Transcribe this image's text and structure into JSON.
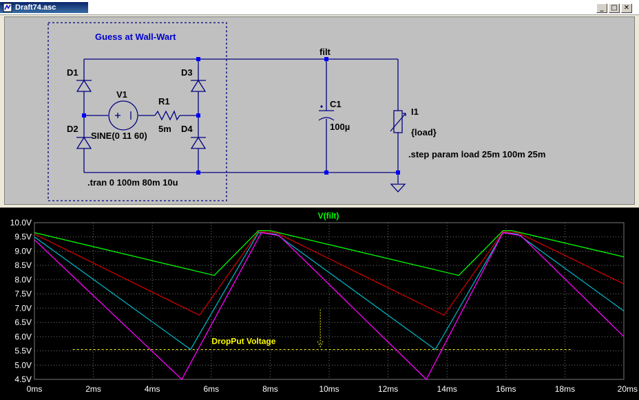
{
  "window": {
    "title": "Draft74.asc",
    "buttons": {
      "minimize": "_",
      "maximize": "□",
      "close": "✕"
    }
  },
  "schematic": {
    "box_label": "Guess at Wall-Wart",
    "net_label": "filt",
    "components": {
      "d1": "D1",
      "d2": "D2",
      "d3": "D3",
      "d4": "D4",
      "v1": "V1",
      "v1_value": "SINE(0 11 60)",
      "r1": "R1",
      "r1_value": "5m",
      "c1": "C1",
      "c1_value": "100µ",
      "i1": "I1",
      "i1_value": "{load}"
    },
    "directives": {
      "tran": ".tran 0 100m 80m 10u",
      "step": ".step param load 25m 100m 25m"
    },
    "colors": {
      "wire": "#000080",
      "label": "#0000cc",
      "junction": "#0000ff",
      "background": "#c0c0c0"
    }
  },
  "plot": {
    "annotation": "DropPut Voltage",
    "colors": {
      "background": "#000000",
      "grid": "#7a7a7a",
      "axis_text": "#ffffff",
      "annotation": "#ffff00"
    }
  },
  "chart_data": {
    "type": "line",
    "title": "V(filt)",
    "xlabel": "",
    "ylabel": "",
    "xlim": [
      0,
      20
    ],
    "ylim": [
      4.5,
      10.0
    ],
    "x_unit": "ms",
    "y_unit": "V",
    "x_ticks": [
      "0ms",
      "2ms",
      "4ms",
      "6ms",
      "8ms",
      "10ms",
      "12ms",
      "14ms",
      "16ms",
      "18ms",
      "20ms"
    ],
    "y_ticks": [
      "10.0V",
      "9.5V",
      "9.0V",
      "8.5V",
      "8.0V",
      "7.5V",
      "7.0V",
      "6.5V",
      "6.0V",
      "5.5V",
      "5.0V",
      "4.5V"
    ],
    "grid": true,
    "reference_line": {
      "y": 5.55,
      "x_start": 1.3,
      "x_end": 18.2,
      "label": "DropPut Voltage",
      "style": "dashed"
    },
    "series": [
      {
        "color": "#00ff00",
        "x": [
          0,
          6.1,
          7.6,
          8.0,
          14.4,
          15.9,
          16.2,
          20
        ],
        "y": [
          9.65,
          8.15,
          9.72,
          9.72,
          8.15,
          9.72,
          9.72,
          8.8
        ]
      },
      {
        "color": "#cc0000",
        "x": [
          0,
          5.6,
          7.6,
          8.2,
          13.9,
          15.9,
          16.4,
          20
        ],
        "y": [
          9.6,
          6.75,
          9.68,
          9.65,
          6.75,
          9.68,
          9.65,
          7.85
        ]
      },
      {
        "color": "#00b0c0",
        "x": [
          0,
          5.3,
          7.6,
          8.2,
          13.6,
          15.9,
          16.4,
          20
        ],
        "y": [
          9.5,
          5.55,
          9.65,
          9.6,
          5.55,
          9.65,
          9.6,
          6.9
        ]
      },
      {
        "color": "#ff00ff",
        "x": [
          0,
          5.0,
          7.7,
          8.3,
          13.3,
          15.9,
          16.5,
          20
        ],
        "y": [
          9.4,
          4.5,
          9.65,
          9.55,
          4.5,
          9.65,
          9.55,
          6.0
        ]
      }
    ]
  }
}
